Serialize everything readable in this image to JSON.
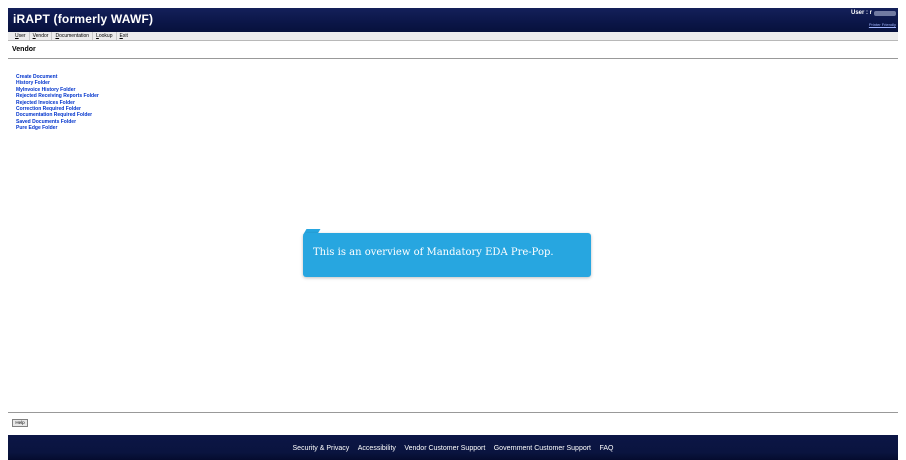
{
  "header": {
    "app_title": "iRAPT (formerly WAWF)",
    "user_label": "User : r",
    "friendly_link": "Printer Friendly"
  },
  "menu": [
    {
      "first": "U",
      "rest": "ser"
    },
    {
      "first": "V",
      "rest": "endor"
    },
    {
      "first": "D",
      "rest": "ocumentation"
    },
    {
      "first": "L",
      "rest": "ookup"
    },
    {
      "first": "E",
      "rest": "xit"
    }
  ],
  "page_title": "Vendor",
  "links": [
    "Create Document",
    "History Folder",
    "MyInvoice History Folder",
    "Rejected Receiving Reports Folder",
    "Rejected Invoices Folder",
    "Correction Required Folder",
    "Documentation Required Folder",
    "Saved Documents Folder",
    "Pure Edge Folder"
  ],
  "callout_text": "This is an overview of Mandatory EDA Pre-Pop.",
  "help_button": "Help",
  "footer_links": [
    "Security & Privacy",
    "Accessibility",
    "Vendor Customer Support",
    "Government Customer Support",
    "FAQ"
  ]
}
